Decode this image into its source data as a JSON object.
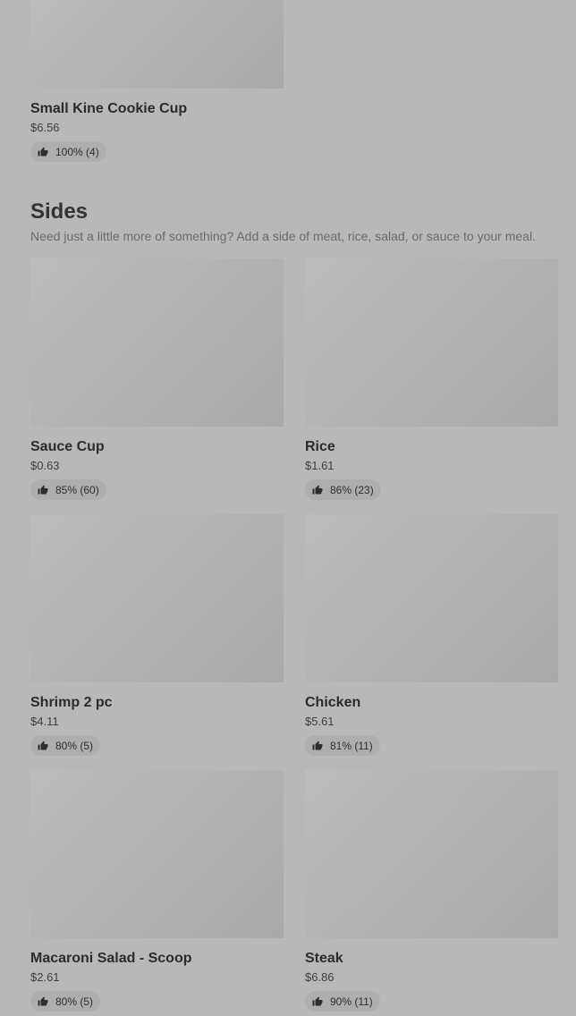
{
  "top_items": [
    {
      "name": "Small Kine Cookie Cup",
      "price": "$6.56",
      "rating": "100% (4)"
    }
  ],
  "sides": {
    "title": "Sides",
    "description": "Need just a little more of something? Add a side of meat, rice, salad, or sauce to your meal.",
    "items": [
      {
        "name": "Sauce Cup",
        "price": "$0.63",
        "rating": "85% (60)"
      },
      {
        "name": "Rice",
        "price": "$1.61",
        "rating": "86% (23)"
      },
      {
        "name": "Shrimp 2 pc",
        "price": "$4.11",
        "rating": "80% (5)"
      },
      {
        "name": "Chicken",
        "price": "$5.61",
        "rating": "81% (11)"
      },
      {
        "name": "Macaroni Salad - Scoop",
        "price": "$2.61",
        "rating": "80% (5)"
      },
      {
        "name": "Steak",
        "price": "$6.86",
        "rating": "90% (11)"
      }
    ]
  },
  "icons": {
    "rating": "thumbs-up-icon"
  }
}
